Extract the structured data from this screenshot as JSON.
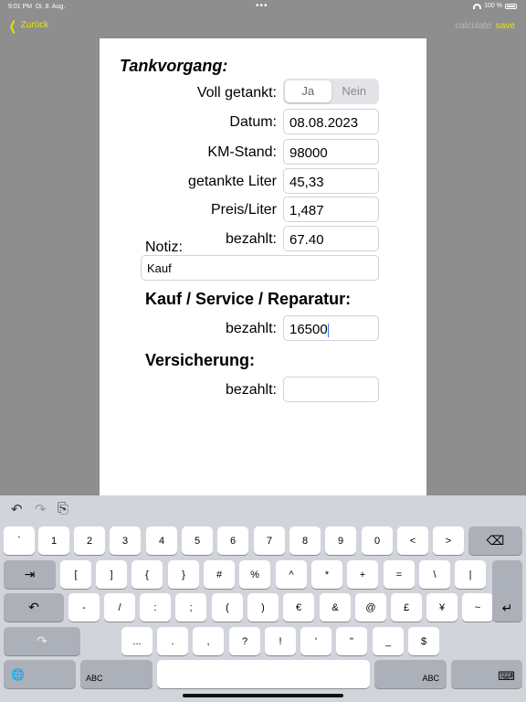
{
  "status": {
    "time": "9:01 PM",
    "date": "Di. 8. Aug.",
    "dots": "•••",
    "battery": "100 %"
  },
  "nav": {
    "back": "Zurück",
    "calculate": "calculate",
    "save": "save"
  },
  "form": {
    "title": "Tankvorgang:",
    "voll_label": "Voll getankt:",
    "voll_options": [
      "Ja",
      "Nein"
    ],
    "datum_label": "Datum:",
    "datum_value": "08.08.2023",
    "km_label": "KM-Stand:",
    "km_value": "98000",
    "liter_label": "getankte Liter",
    "liter_value": "45,33",
    "preis_label": "Preis/Liter",
    "preis_value": "1,487",
    "bezahlt_label": "bezahlt:",
    "bezahlt_value": "67.40",
    "notiz_label": "Notiz:",
    "notiz_value": "Kauf",
    "kauf_title": "Kauf / Service / Reparatur:",
    "kauf_bezahlt_label": "bezahlt:",
    "kauf_bezahlt_value": "16500",
    "vers_title": "Versicherung:",
    "vers_bezahlt_label": "bezahlt:",
    "vers_bezahlt_value": ""
  },
  "keyboard": {
    "toolbar": {
      "undo": "↶",
      "redo": "↷",
      "paste": "⎘"
    },
    "row1": [
      "`",
      "1",
      "2",
      "3",
      "4",
      "5",
      "6",
      "7",
      "8",
      "9",
      "0",
      "<",
      ">"
    ],
    "delete": "⌫",
    "tab": "⇥",
    "row2": [
      "[",
      "]",
      "{",
      "}",
      "#",
      "%",
      "^",
      "*",
      "+",
      "=",
      "\\",
      "|"
    ],
    "undo_key": "↶",
    "row3": [
      "-",
      "/",
      ":",
      ";",
      "(",
      ")",
      "€",
      "&",
      "@",
      "£",
      "¥",
      "~"
    ],
    "return": "↵",
    "redo_key": "↷",
    "row4": [
      "...",
      ".",
      ",",
      "?",
      "!",
      "'",
      "\"",
      "_",
      "$"
    ],
    "globe": "🌐",
    "abc_left": "ABC",
    "abc_right": "ABC",
    "hide": "⌨"
  }
}
